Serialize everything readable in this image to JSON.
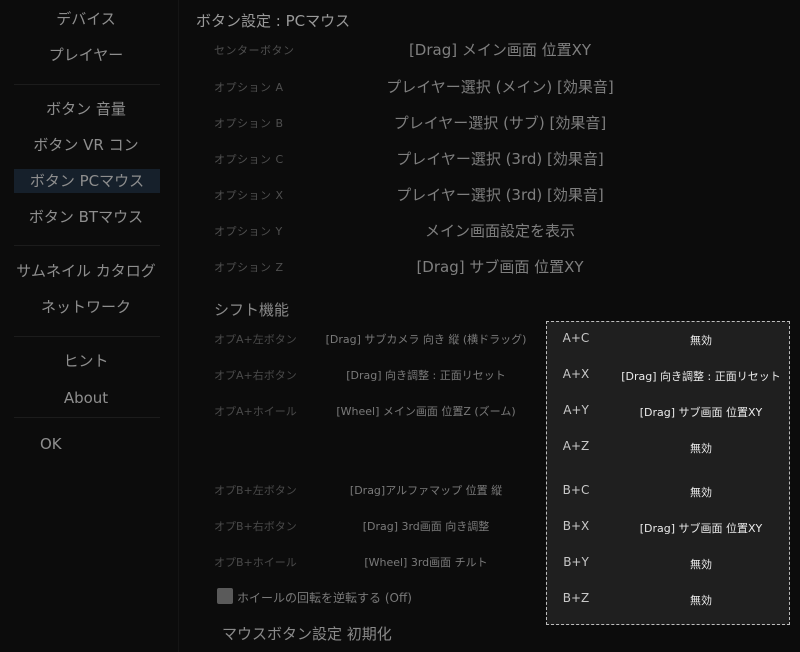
{
  "sidebar": {
    "items": [
      {
        "label": "デバイス"
      },
      {
        "label": "プレイヤー"
      },
      {
        "label": "ボタン 音量"
      },
      {
        "label": "ボタン VR コン"
      },
      {
        "label": "ボタン PCマウス"
      },
      {
        "label": "ボタン BTマウス"
      },
      {
        "label": "サムネイル カタログ"
      },
      {
        "label": "ネットワーク"
      },
      {
        "label": "ヒント"
      },
      {
        "label": "About"
      }
    ],
    "ok_label": "OK"
  },
  "main": {
    "title": "ボタン設定 : PCマウス",
    "rows": [
      {
        "label": "センターボタン",
        "value": "[Drag] メイン画面 位置XY"
      },
      {
        "label": "オプション A",
        "value": "プレイヤー選択 (メイン) [効果音]"
      },
      {
        "label": "オプション B",
        "value": "プレイヤー選択 (サブ) [効果音]"
      },
      {
        "label": "オプション C",
        "value": "プレイヤー選択 (3rd) [効果音]"
      },
      {
        "label": "オプション X",
        "value": "プレイヤー選択 (3rd) [効果音]"
      },
      {
        "label": "オプション Y",
        "value": "メイン画面設定を表示"
      },
      {
        "label": "オプション Z",
        "value": "[Drag] サブ画面 位置XY"
      }
    ],
    "shift_title": "シフト機能",
    "shift_rows": [
      {
        "label": "オプA+左ボタン",
        "value": "[Drag] サブカメラ 向き 縦 (横ドラッグ)"
      },
      {
        "label": "オプA+右ボタン",
        "value": "[Drag] 向き調整 : 正面リセット"
      },
      {
        "label": "オプA+ホイール",
        "value": "[Wheel] メイン画面 位置Z (ズーム)"
      },
      {
        "label": "オプB+左ボタン",
        "value": "[Drag]アルファマップ 位置 縦"
      },
      {
        "label": "オプB+右ボタン",
        "value": "[Drag] 3rd画面 向き調整"
      },
      {
        "label": "オプB+ホイール",
        "value": "[Wheel] 3rd画面 チルト"
      }
    ],
    "invert_wheel_label": "ホイールの回転を逆転する (Off)",
    "reset_label": "マウスボタン設定 初期化"
  },
  "popup": {
    "items": [
      {
        "key": "A+C",
        "value": "無効"
      },
      {
        "key": "A+X",
        "value": "[Drag] 向き調整 : 正面リセット"
      },
      {
        "key": "A+Y",
        "value": "[Drag] サブ画面 位置XY"
      },
      {
        "key": "A+Z",
        "value": "無効"
      },
      {
        "key": "B+C",
        "value": "無効"
      },
      {
        "key": "B+X",
        "value": "[Drag] サブ画面 位置XY"
      },
      {
        "key": "B+Y",
        "value": "無効"
      },
      {
        "key": "B+Z",
        "value": "無効"
      }
    ]
  }
}
